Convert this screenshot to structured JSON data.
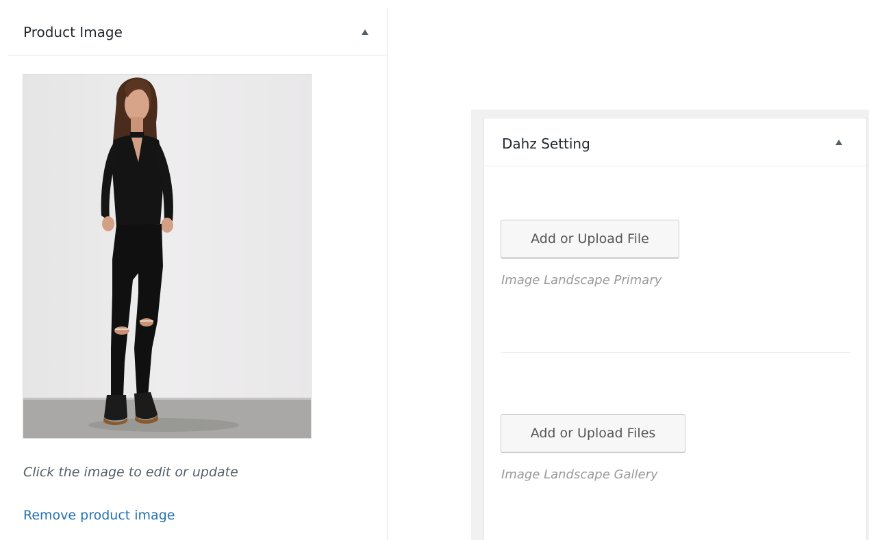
{
  "product_image_box": {
    "title": "Product Image",
    "toggle_icon": "triangle-up-icon",
    "image_alt": "Product photo: woman in black top and ripped black jeans",
    "hint": "Click the image to edit or update",
    "remove_link": "Remove product image"
  },
  "dahz_setting_box": {
    "title": "Dahz Setting",
    "toggle_icon": "triangle-up-icon",
    "fields": [
      {
        "button_label": "Add or Upload File",
        "description": "Image Landscape Primary"
      },
      {
        "button_label": "Add or Upload Files",
        "description": "Image Landscape Gallery"
      }
    ]
  },
  "colors": {
    "link": "#2271b1",
    "heading": "#23282d",
    "muted": "#999999",
    "border": "#e5e5e5",
    "button_bg": "#f7f7f7"
  }
}
